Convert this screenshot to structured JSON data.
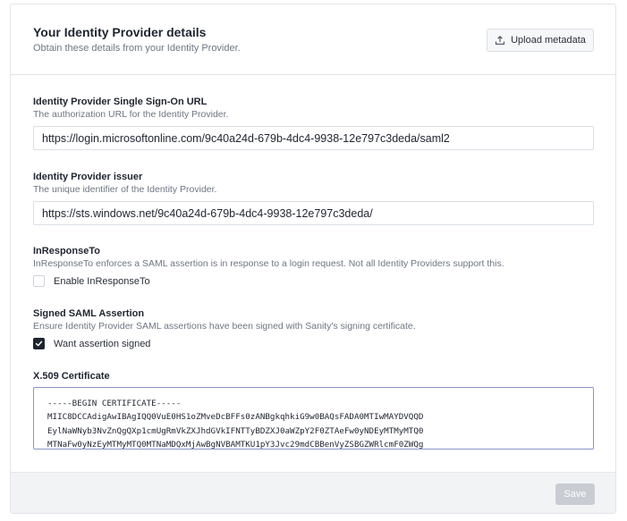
{
  "header": {
    "title": "Your Identity Provider details",
    "subtitle": "Obtain these details from your Identity Provider.",
    "upload_button_label": "Upload metadata",
    "upload_icon": "upload-icon"
  },
  "sso_url": {
    "label": "Identity Provider Single Sign-On URL",
    "description": "The authorization URL for the Identity Provider.",
    "value": "https://login.microsoftonline.com/9c40a24d-679b-4dc4-9938-12e797c3deda/saml2"
  },
  "issuer": {
    "label": "Identity Provider issuer",
    "description": "The unique identifier of the Identity Provider.",
    "value": "https://sts.windows.net/9c40a24d-679b-4dc4-9938-12e797c3deda/"
  },
  "in_response_to": {
    "label": "InResponseTo",
    "description": "InResponseTo enforces a SAML assertion is in response to a login request. Not all Identity Providers support this.",
    "checkbox_label": "Enable InResponseTo",
    "checked": false
  },
  "signed_assertion": {
    "label": "Signed SAML Assertion",
    "description": "Ensure Identity Provider SAML assertions have been signed with Sanity's signing certificate.",
    "checkbox_label": "Want assertion signed",
    "checked": true,
    "check_icon": "checkmark-icon"
  },
  "certificate": {
    "label": "X.509 Certificate",
    "lines": [
      "-----BEGIN CERTIFICATE-----",
      "MIIC8DCCAdigAwIBAgIQQ0VuE0HS1oZMveDcBFFs0zANBgkqhkiG9w0BAQsFADA0MTIwMAYDVQQD",
      "EylNaWNyb3NvZnQgQXp1cmUgRmVkZXJhdGVkIFNTTyBDZXJ0aWZpY2F0ZTAeFw0yNDEyMTMyMTQ0",
      "MTNaFw0yNzEyMTMyMTQ0MTNaMDQxMjAwBgNVBAMTKU1pY3Jvc29mdCBBenVyZSBGZWRlcmF0ZWQg"
    ]
  },
  "footer": {
    "save_label": "Save"
  },
  "colors": {
    "accent_border": "#8b95c9",
    "save_disabled": "#c9ccd2",
    "checkbox_checked": "#1f2430"
  }
}
